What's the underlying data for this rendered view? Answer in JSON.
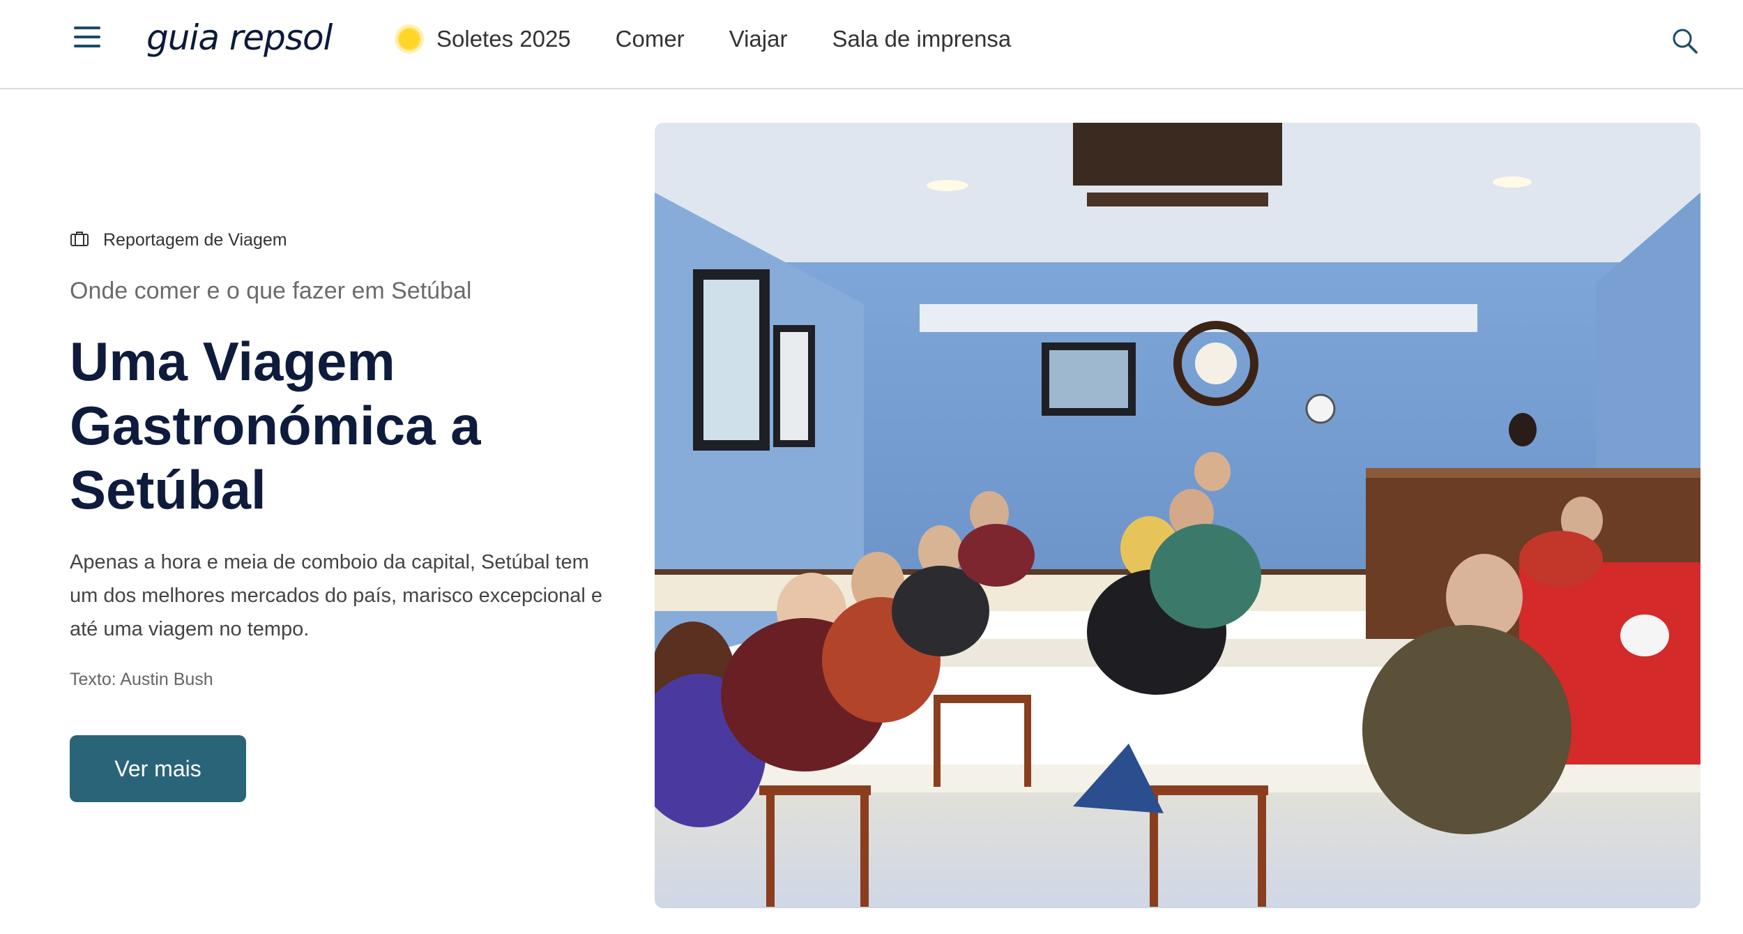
{
  "header": {
    "menu_icon": "hamburger-icon",
    "logo": "guia repsol",
    "nav": [
      {
        "label": "Soletes 2025",
        "icon": "sun-icon"
      },
      {
        "label": "Comer"
      },
      {
        "label": "Viajar"
      },
      {
        "label": "Sala de imprensa"
      }
    ],
    "search_icon": "search-icon"
  },
  "article": {
    "category": "Reportagem de Viagem",
    "category_icon": "suitcase-icon",
    "kicker": "Onde comer e o que fazer em Setúbal",
    "title": "Uma Viagem Gastronómica a Setúbal",
    "lede": "Apenas a hora e meia de comboio da capital, Setúbal tem um dos melhores mercados do país, marisco excepcional e até uma viagem no tempo.",
    "author": "Texto: Austin Bush",
    "cta": "Ver mais"
  },
  "colors": {
    "brand_navy": "#0f1b3d",
    "button": "#2a6478",
    "sun": "#ffd528",
    "icon": "#1b4b66"
  }
}
